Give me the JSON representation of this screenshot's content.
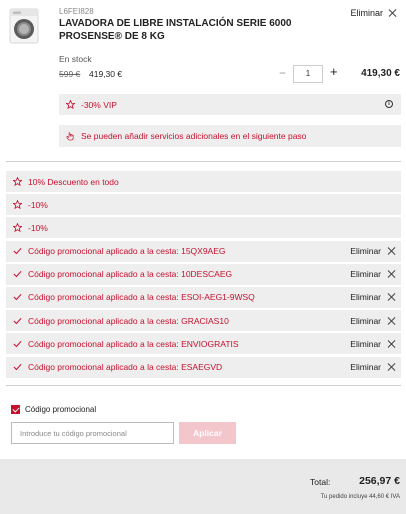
{
  "product": {
    "sku": "L6FEI828",
    "name": "LAVADORA DE LIBRE INSTALACIÓN SERIE 6000 PROSENSE® DE 8 KG",
    "remove_label": "Eliminar",
    "stock": "En stock",
    "old_price": "599 €",
    "new_price": "419,30 €",
    "quantity": "1",
    "line_total": "419,30 €",
    "vip_label": "-30% VIP",
    "services_note": "Se pueden añadir servicios adicionales en el siguiente paso"
  },
  "discounts": [
    {
      "label": "10% Descuento en todo",
      "icon": "star-icon",
      "removable": false
    },
    {
      "label": "-10%",
      "icon": "star-icon",
      "removable": false
    },
    {
      "label": "-10%",
      "icon": "star-icon",
      "removable": false
    },
    {
      "label": "Código promocional aplicado a la cesta: 15QX9AEG",
      "icon": "check-icon",
      "removable": true
    },
    {
      "label": "Código promocional aplicado a la cesta: 10DESCAEG",
      "icon": "check-icon",
      "removable": true
    },
    {
      "label": "Código promocional aplicado a la cesta: ESOI-AEG1-9WSQ",
      "icon": "check-icon",
      "removable": true
    },
    {
      "label": "Código promocional aplicado a la cesta: GRACIAS10",
      "icon": "check-icon",
      "removable": true
    },
    {
      "label": "Código promocional aplicado a la cesta: ENVIOGRATIS",
      "icon": "check-icon",
      "removable": true
    },
    {
      "label": "Código promocional aplicado a la cesta: ESAEGVD",
      "icon": "check-icon",
      "removable": true
    }
  ],
  "remove_label": "Eliminar",
  "promo": {
    "checkbox_label": "Código promocional",
    "checked": true,
    "placeholder": "Introduce tu código promocional",
    "apply_label": "Aplicar"
  },
  "totals": {
    "label": "Total:",
    "value": "256,97 €",
    "iva_note": "Tu pedido incluye 44,60 € IVA"
  },
  "colors": {
    "accent": "#c8102e",
    "row_bg": "#eeeeee",
    "apply_disabled": "#f3c6cc"
  }
}
